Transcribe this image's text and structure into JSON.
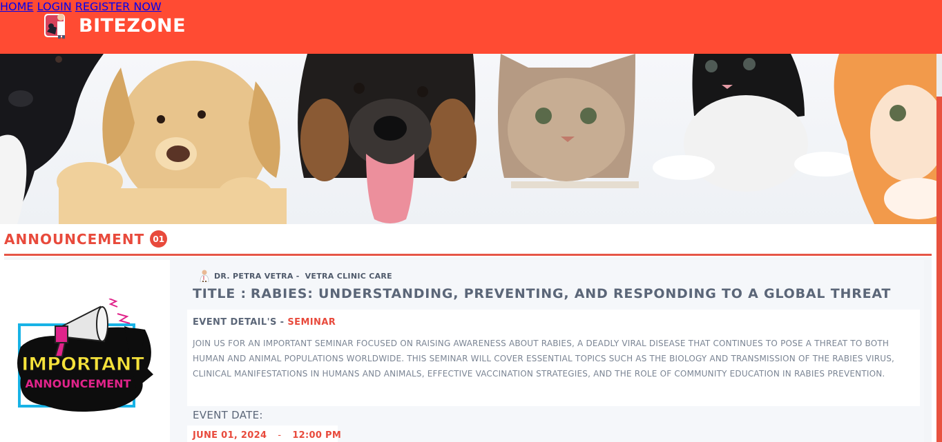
{
  "header": {
    "brand": "BITEZONE",
    "nav": [
      {
        "label": "HOME"
      },
      {
        "label": "LOGIN"
      },
      {
        "label": "REGISTER NOW"
      }
    ]
  },
  "announcement": {
    "heading": "ANNOUNCEMENT",
    "count": "01",
    "badge_line1": "IMPORTANT",
    "badge_line2": "ANNOUNCEMENT",
    "author": "DR. PETRA VETRA",
    "author_separator": "-",
    "clinic": "VETRA CLINIC CARE",
    "title_prefix": "TITLE :",
    "title": "RABIES: UNDERSTANDING, PREVENTING, AND RESPONDING TO A GLOBAL THREAT",
    "detail_heading": "EVENT DETAIL'S -",
    "detail_type": "SEMINAR",
    "detail_text": "JOIN US FOR AN IMPORTANT SEMINAR FOCUSED ON RAISING AWARENESS ABOUT RABIES, A DEADLY VIRAL DISEASE THAT CONTINUES TO POSE A THREAT TO BOTH HUMAN AND ANIMAL POPULATIONS WORLDWIDE. THIS SEMINAR WILL COVER ESSENTIAL TOPICS SUCH AS THE BIOLOGY AND TRANSMISSION OF THE RABIES VIRUS, CLINICAL MANIFESTATIONS IN HUMANS AND ANIMALS, EFFECTIVE VACCINATION STRATEGIES, AND THE ROLE OF COMMUNITY EDUCATION IN RABIES PREVENTION.",
    "date_label": "EVENT DATE:",
    "date": "JUNE 01, 2024",
    "date_separator": "-",
    "time": "12:00 PM"
  },
  "colors": {
    "header": "#ff4b33",
    "accent": "#e84a3c",
    "text": "#5b6678"
  },
  "icons": {
    "logo": "vet-doctor-logo-icon",
    "author": "doctor-icon",
    "badge": "megaphone-icon"
  }
}
